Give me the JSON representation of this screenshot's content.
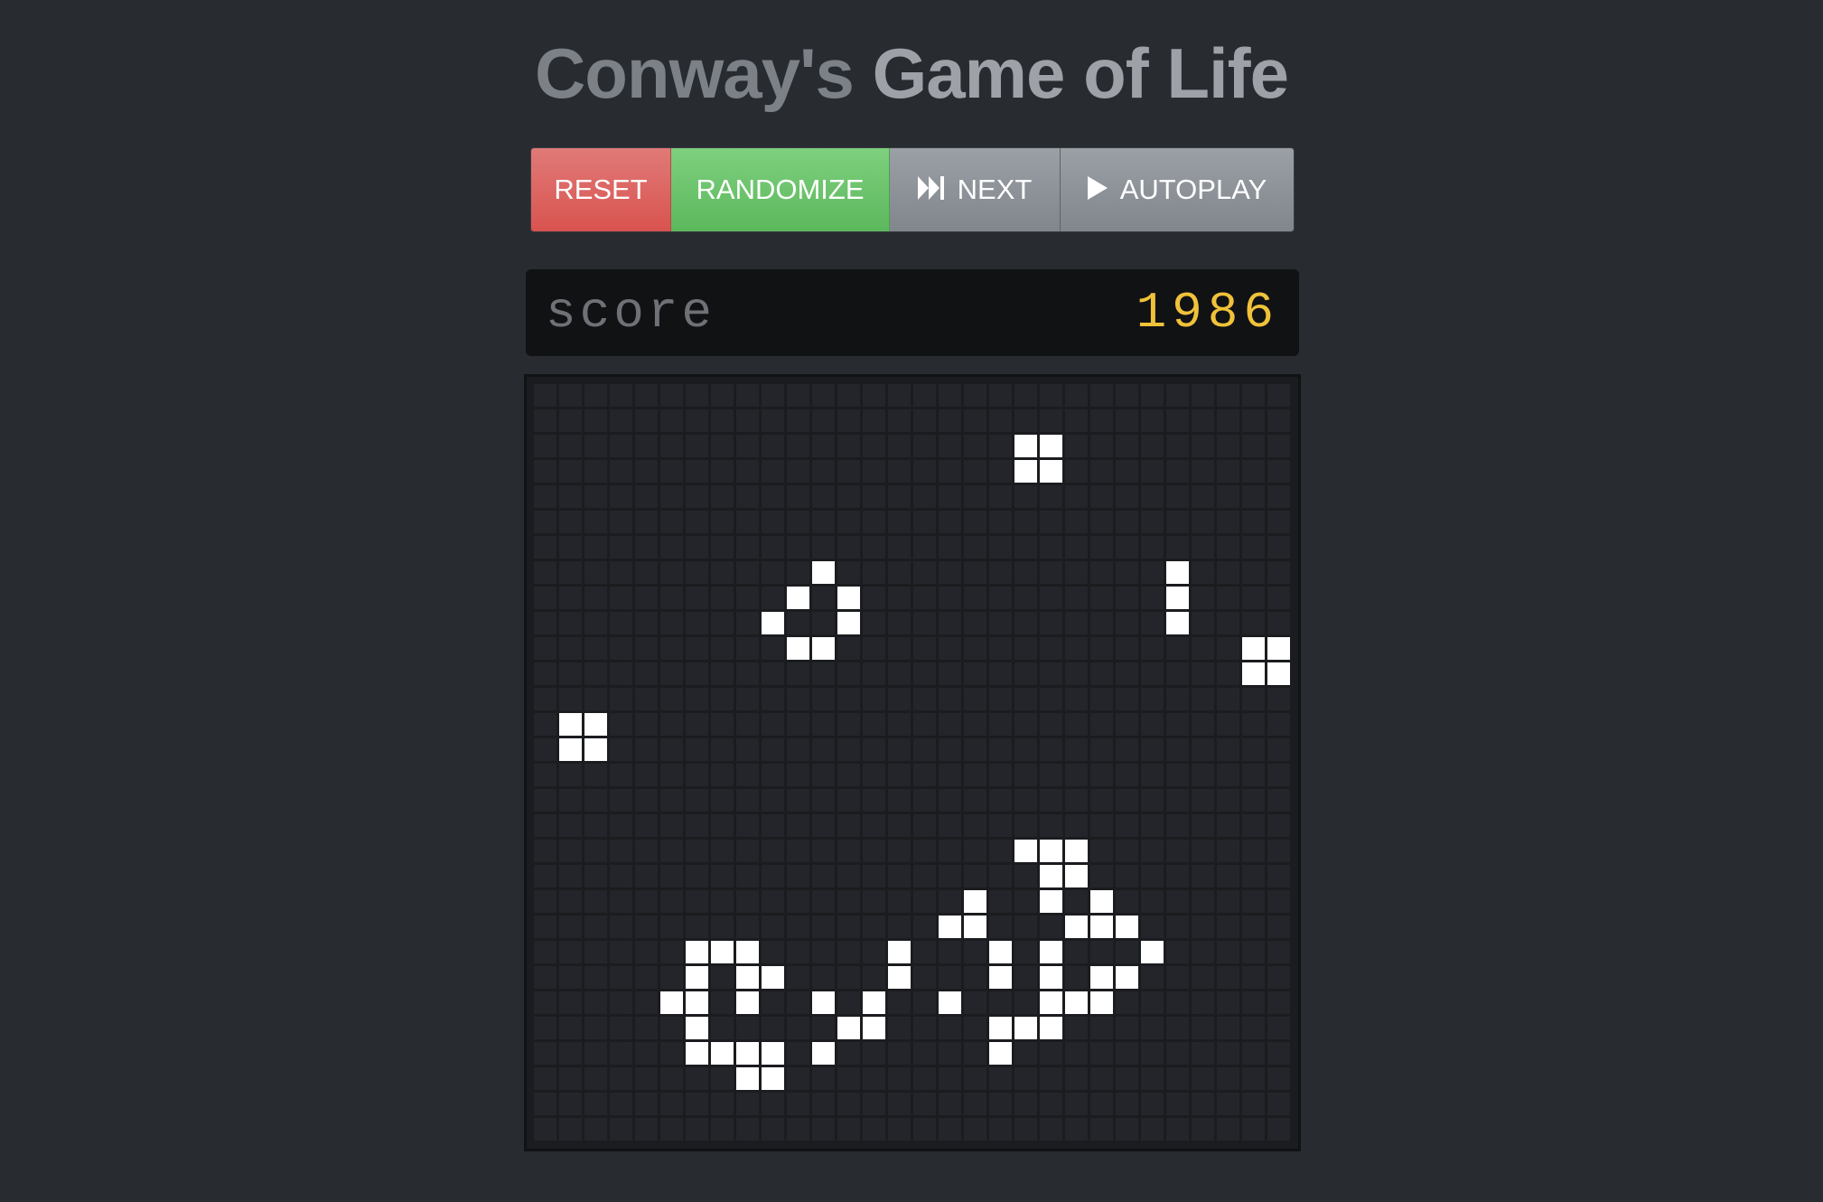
{
  "title": {
    "part1": "Conway's",
    "part2": "Game of Life"
  },
  "toolbar": {
    "reset_label": "RESET",
    "randomize_label": "RANDOMIZE",
    "next_label": "NEXT",
    "autoplay_label": "AUTOPLAY",
    "next_icon": "fast-forward-icon",
    "autoplay_icon": "play-icon"
  },
  "score": {
    "label": "score",
    "value": "1986"
  },
  "colors": {
    "background": "#282b30",
    "reset": "#d9534f",
    "randomize": "#5cb85c",
    "neutral": "#80868c",
    "score_value": "#f0c23a",
    "cell_dead": "#23252a",
    "cell_alive": "#ffffff"
  },
  "grid": {
    "cols": 30,
    "rows": 30,
    "alive": [
      [
        19,
        2
      ],
      [
        20,
        2
      ],
      [
        19,
        3
      ],
      [
        20,
        3
      ],
      [
        11,
        7
      ],
      [
        10,
        8
      ],
      [
        12,
        8
      ],
      [
        9,
        9
      ],
      [
        12,
        9
      ],
      [
        10,
        10
      ],
      [
        11,
        10
      ],
      [
        25,
        7
      ],
      [
        25,
        8
      ],
      [
        25,
        9
      ],
      [
        28,
        10
      ],
      [
        29,
        10
      ],
      [
        28,
        11
      ],
      [
        29,
        11
      ],
      [
        1,
        13
      ],
      [
        2,
        13
      ],
      [
        1,
        14
      ],
      [
        2,
        14
      ],
      [
        19,
        18
      ],
      [
        20,
        18
      ],
      [
        21,
        18
      ],
      [
        20,
        19
      ],
      [
        21,
        19
      ],
      [
        17,
        20
      ],
      [
        20,
        20
      ],
      [
        22,
        20
      ],
      [
        16,
        21
      ],
      [
        17,
        21
      ],
      [
        21,
        21
      ],
      [
        22,
        21
      ],
      [
        23,
        21
      ],
      [
        6,
        22
      ],
      [
        7,
        22
      ],
      [
        8,
        22
      ],
      [
        14,
        22
      ],
      [
        18,
        22
      ],
      [
        20,
        22
      ],
      [
        24,
        22
      ],
      [
        6,
        23
      ],
      [
        8,
        23
      ],
      [
        9,
        23
      ],
      [
        14,
        23
      ],
      [
        18,
        23
      ],
      [
        20,
        23
      ],
      [
        22,
        23
      ],
      [
        23,
        23
      ],
      [
        5,
        24
      ],
      [
        6,
        24
      ],
      [
        8,
        24
      ],
      [
        11,
        24
      ],
      [
        13,
        24
      ],
      [
        16,
        24
      ],
      [
        20,
        24
      ],
      [
        21,
        24
      ],
      [
        22,
        24
      ],
      [
        6,
        25
      ],
      [
        12,
        25
      ],
      [
        13,
        25
      ],
      [
        18,
        25
      ],
      [
        19,
        25
      ],
      [
        20,
        25
      ],
      [
        6,
        26
      ],
      [
        7,
        26
      ],
      [
        8,
        26
      ],
      [
        9,
        26
      ],
      [
        11,
        26
      ],
      [
        18,
        26
      ],
      [
        8,
        27
      ],
      [
        9,
        27
      ]
    ]
  }
}
